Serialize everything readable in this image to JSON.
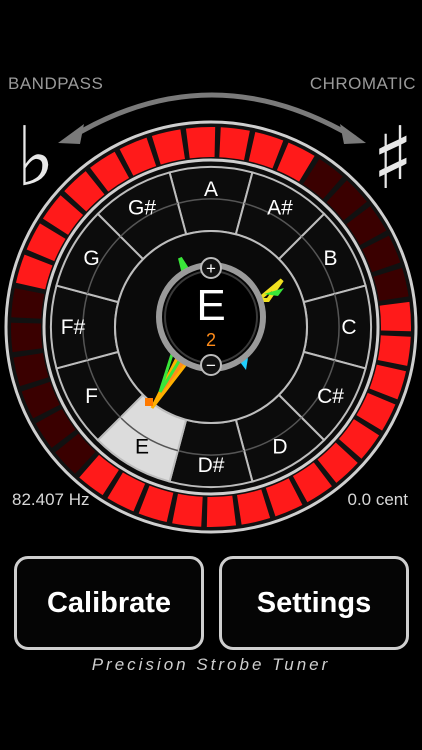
{
  "mode": {
    "left_label": "BANDPASS",
    "right_label": "CHROMATIC"
  },
  "tuner": {
    "note": "E",
    "octave": "2",
    "plus_symbol": "+",
    "minus_symbol": "−",
    "frequency": "82.407 Hz",
    "cents": "0.0 cent",
    "notes": [
      "A",
      "A#",
      "B",
      "C",
      "C#",
      "D",
      "D#",
      "E",
      "F",
      "F#",
      "G",
      "G#"
    ],
    "selected_note": "E",
    "flat_symbol": "♭",
    "sharp_symbol": "♯"
  },
  "buttons": {
    "calibrate_label": "Calibrate",
    "settings_label": "Settings"
  },
  "footer": {
    "title": "Precision Strobe Tuner"
  },
  "colors": {
    "strobe_on": "#ff1a1a",
    "strobe_off": "#3a0000",
    "selected_cell": "#dcdcdc",
    "arrow": "#7a7a7a"
  }
}
